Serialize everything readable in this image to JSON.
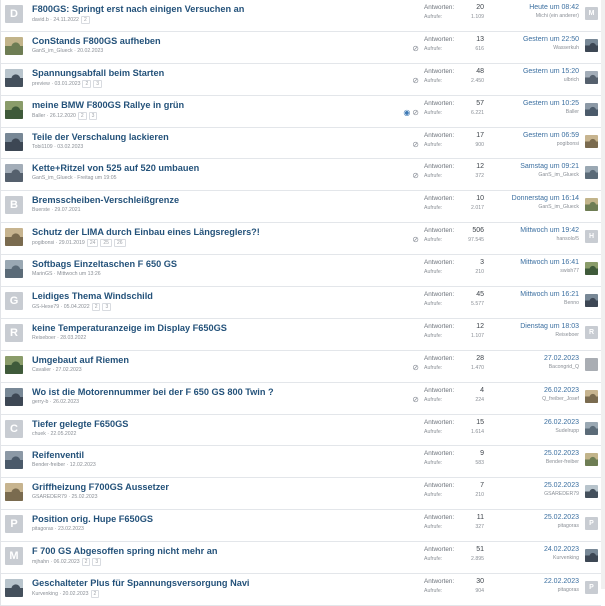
{
  "labels": {
    "answers": "Antworten:",
    "views": "Aufrufe:"
  },
  "threads": [
    {
      "avatar": "D",
      "title": "F800GS: Springt erst nach einigen Versuchen an",
      "author": "david.b",
      "date": "24.11.2022",
      "pages": [
        "2"
      ],
      "answers": "20",
      "views": "1.109",
      "last_date": "Heute um 08:42",
      "last_user": "Michi (ein anderer)",
      "last_avatar": "M",
      "attach": false,
      "watch": false
    },
    {
      "avatar": "photo",
      "title": "ConStands F800GS aufheben",
      "author": "GanS_im_Glueck",
      "date": "20.02.2023",
      "pages": [],
      "answers": "13",
      "views": "616",
      "last_date": "Gestern um 22:50",
      "last_user": "Wasserkuh",
      "last_avatar": "photo",
      "attach": true,
      "watch": false
    },
    {
      "avatar": "photo",
      "title": "Spannungsabfall beim Starten",
      "author": "preview",
      "date": "03.01.2023",
      "pages": [
        "2",
        "3"
      ],
      "answers": "48",
      "views": "2.450",
      "last_date": "Gestern um 15:20",
      "last_user": "ulbrich",
      "last_avatar": "photo",
      "attach": true,
      "watch": false
    },
    {
      "avatar": "photo",
      "title": "meine BMW F800GS Rallye in grün",
      "author": "Baller",
      "date": "26.12.2020",
      "pages": [
        "2",
        "3"
      ],
      "answers": "57",
      "views": "6.221",
      "last_date": "Gestern um 10:25",
      "last_user": "Baller",
      "last_avatar": "photo",
      "attach": true,
      "watch": true
    },
    {
      "avatar": "photo",
      "title": "Teile der Verschalung lackieren",
      "author": "Tobi1109",
      "date": "03.02.2023",
      "pages": [],
      "answers": "17",
      "views": "900",
      "last_date": "Gestern um 06:59",
      "last_user": "pogibonsi",
      "last_avatar": "photo",
      "attach": true,
      "watch": false
    },
    {
      "avatar": "photo",
      "title": "Kette+Ritzel von 525 auf 520 umbauen",
      "author": "GanS_im_Glueck",
      "date": "Freitag um 19:05",
      "pages": [],
      "answers": "12",
      "views": "372",
      "last_date": "Samstag um 09:21",
      "last_user": "GanS_im_Glueck",
      "last_avatar": "photo",
      "attach": true,
      "watch": false
    },
    {
      "avatar": "B",
      "title": "Bremsscheiben-Verschleißgrenze",
      "author": "Buerste",
      "date": "29.07.2021",
      "pages": [],
      "answers": "10",
      "views": "2.017",
      "last_date": "Donnerstag um 16:14",
      "last_user": "GanS_im_Glueck",
      "last_avatar": "photo",
      "attach": false,
      "watch": false
    },
    {
      "avatar": "photo",
      "title": "Schutz der LIMA durch Einbau eines Längsreglers?!",
      "author": "pogibonsi",
      "date": "29.01.2019",
      "pages": [
        "24",
        "25",
        "26"
      ],
      "answers": "506",
      "views": "97.545",
      "last_date": "Mittwoch um 19:42",
      "last_user": "hansolo/5",
      "last_avatar": "H",
      "attach": true,
      "watch": false
    },
    {
      "avatar": "photo",
      "title": "Softbags Einzeltaschen F 650 GS",
      "author": "MarinGS",
      "date": "Mittwoch um 13:26",
      "pages": [],
      "answers": "3",
      "views": "210",
      "last_date": "Mittwoch um 16:41",
      "last_user": "swish77",
      "last_avatar": "photo",
      "attach": false,
      "watch": false
    },
    {
      "avatar": "G",
      "title": "Leidiges Thema Windschild",
      "author": "GS-Hexe79",
      "date": "05.04.2022",
      "pages": [
        "2",
        "3"
      ],
      "answers": "45",
      "views": "5.577",
      "last_date": "Mittwoch um 16:21",
      "last_user": "Benno",
      "last_avatar": "photo",
      "attach": false,
      "watch": false
    },
    {
      "avatar": "R",
      "title": "keine Temperaturanzeige im Display F650GS",
      "author": "Reiseboer",
      "date": "28.03.2022",
      "pages": [],
      "answers": "12",
      "views": "1.107",
      "last_date": "Dienstag um 18:03",
      "last_user": "Reiseboer",
      "last_avatar": "R",
      "attach": false,
      "watch": false
    },
    {
      "avatar": "photo",
      "title": "Umgebaut auf Riemen",
      "author": "Cavalier",
      "date": "27.02.2023",
      "pages": [],
      "answers": "28",
      "views": "1.470",
      "last_date": "27.02.2023",
      "last_user": "Bacongrid_Q",
      "last_avatar": "gray",
      "attach": true,
      "watch": false
    },
    {
      "avatar": "photo",
      "title": "Wo ist die Motorennummer bei der F 650 GS 800 Twin ?",
      "author": "gerry-b",
      "date": "26.02.2023",
      "pages": [],
      "answers": "4",
      "views": "224",
      "last_date": "26.02.2023",
      "last_user": "Q_freiber_Josef",
      "last_avatar": "photo",
      "attach": true,
      "watch": false
    },
    {
      "avatar": "C",
      "title": "Tiefer gelegte F650GS",
      "author": "chuek",
      "date": "22.05.2022",
      "pages": [],
      "answers": "15",
      "views": "1.614",
      "last_date": "26.02.2023",
      "last_user": "Sudelrupp",
      "last_avatar": "photo",
      "attach": false,
      "watch": false
    },
    {
      "avatar": "photo",
      "title": "Reifenventil",
      "author": "Bender-freiber",
      "date": "12.02.2023",
      "pages": [],
      "answers": "9",
      "views": "583",
      "last_date": "25.02.2023",
      "last_user": "Bender-freiber",
      "last_avatar": "photo",
      "attach": false,
      "watch": false
    },
    {
      "avatar": "photo",
      "title": "Griffheizung F700GS Aussetzer",
      "author": "GSAREDER79",
      "date": "25.02.2023",
      "pages": [],
      "answers": "7",
      "views": "210",
      "last_date": "25.02.2023",
      "last_user": "GSAREDER79",
      "last_avatar": "photo",
      "attach": false,
      "watch": false
    },
    {
      "avatar": "P",
      "title": "Position orig. Hupe F650GS",
      "author": "pitagoras",
      "date": "23.02.2023",
      "pages": [],
      "answers": "11",
      "views": "327",
      "last_date": "25.02.2023",
      "last_user": "pitagoras",
      "last_avatar": "P",
      "attach": false,
      "watch": false
    },
    {
      "avatar": "M",
      "title": "F 700 GS Abgesoffen spring nicht mehr an",
      "author": "mjhahn",
      "date": "06.02.2023",
      "pages": [
        "2",
        "3"
      ],
      "answers": "51",
      "views": "2.895",
      "last_date": "24.02.2023",
      "last_user": "Kurvenking",
      "last_avatar": "photo",
      "attach": false,
      "watch": false
    },
    {
      "avatar": "photo",
      "title": "Geschalteter Plus für Spannungsversorgung Navi",
      "author": "Kurvenking",
      "date": "20.02.2023",
      "pages": [
        "2"
      ],
      "answers": "30",
      "views": "904",
      "last_date": "22.02.2023",
      "last_user": "pitagoras",
      "last_avatar": "P",
      "attach": false,
      "watch": false
    }
  ]
}
